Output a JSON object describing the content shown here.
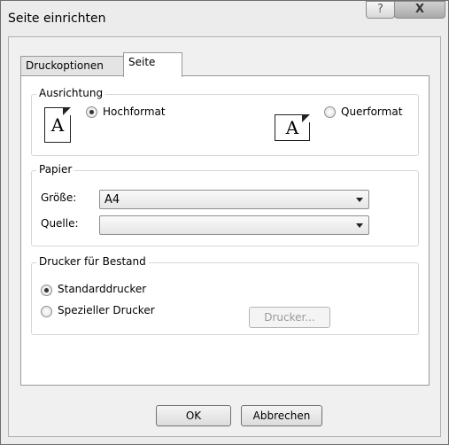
{
  "window": {
    "title": "Seite einrichten",
    "help_glyph": "?",
    "close_glyph": "X"
  },
  "tabs": [
    {
      "label": "Druckoptionen",
      "active": false
    },
    {
      "label": "Seite",
      "active": true
    }
  ],
  "orientation": {
    "legend": "Ausrichtung",
    "portrait_label": "Hochformat",
    "landscape_label": "Querformat",
    "selected": "Hochformat",
    "icon_letter": "A"
  },
  "paper": {
    "legend": "Papier",
    "size_label": "Größe:",
    "size_value": "A4",
    "source_label": "Quelle:",
    "source_value": ""
  },
  "printer": {
    "legend": "Drucker für Bestand",
    "default_label": "Standarddrucker",
    "specific_label": "Spezieller Drucker",
    "selected": "Standarddrucker",
    "printer_button": "Drucker..."
  },
  "footer": {
    "ok": "OK",
    "cancel": "Abbrechen"
  }
}
